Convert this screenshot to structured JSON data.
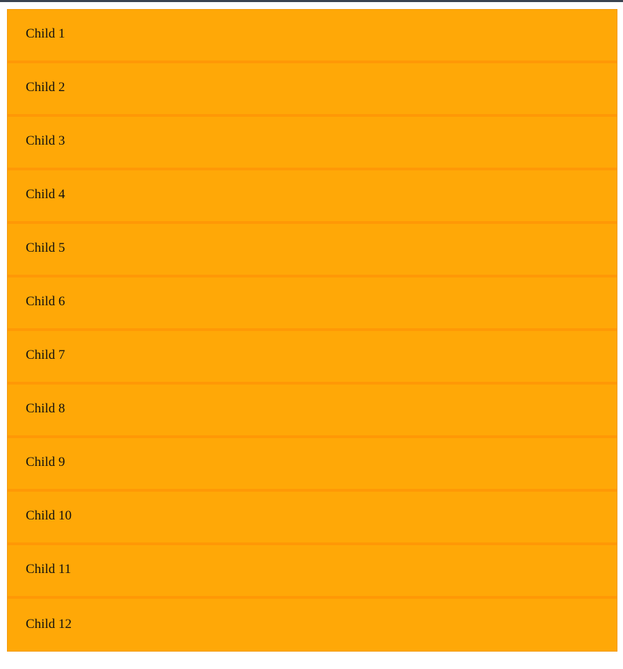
{
  "colors": {
    "top_bar": "#3a4350",
    "item_background": "#ffa807",
    "item_divider": "#ff9806",
    "container_border": "#f29a10",
    "text": "#111111"
  },
  "children": [
    {
      "label": "Child 1"
    },
    {
      "label": "Child 2"
    },
    {
      "label": "Child 3"
    },
    {
      "label": "Child 4"
    },
    {
      "label": "Child 5"
    },
    {
      "label": "Child 6"
    },
    {
      "label": "Child 7"
    },
    {
      "label": "Child 8"
    },
    {
      "label": "Child 9"
    },
    {
      "label": "Child 10"
    },
    {
      "label": "Child 11"
    },
    {
      "label": "Child 12"
    }
  ]
}
